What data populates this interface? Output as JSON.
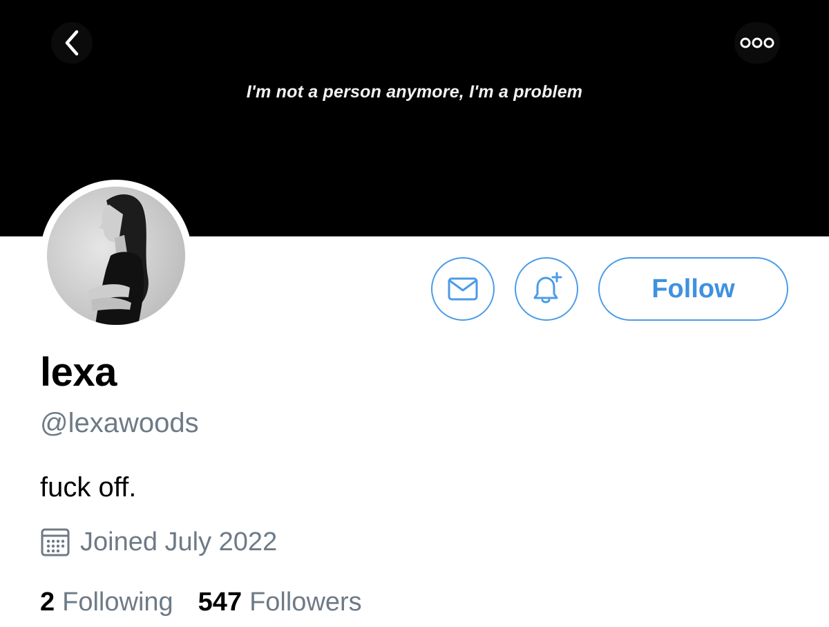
{
  "header": {
    "banner_caption": "I'm not a person anymore, I'm a problem",
    "back_icon": "chevron-left-icon",
    "more_icon": "more-horizontal-icon"
  },
  "profile": {
    "display_name": "lexa",
    "handle": "@lexawoods",
    "bio": "fuck off.",
    "joined": "Joined July 2022",
    "joined_icon": "calendar-icon"
  },
  "actions": {
    "message_icon": "mail-icon",
    "notify_icon": "bell-plus-icon",
    "follow_label": "Follow"
  },
  "stats": {
    "following_count": "2",
    "following_label": "Following",
    "followers_count": "547",
    "followers_label": "Followers"
  },
  "colors": {
    "accent": "#4a9be8",
    "muted_text": "#6e7a86",
    "banner": "#000000"
  }
}
